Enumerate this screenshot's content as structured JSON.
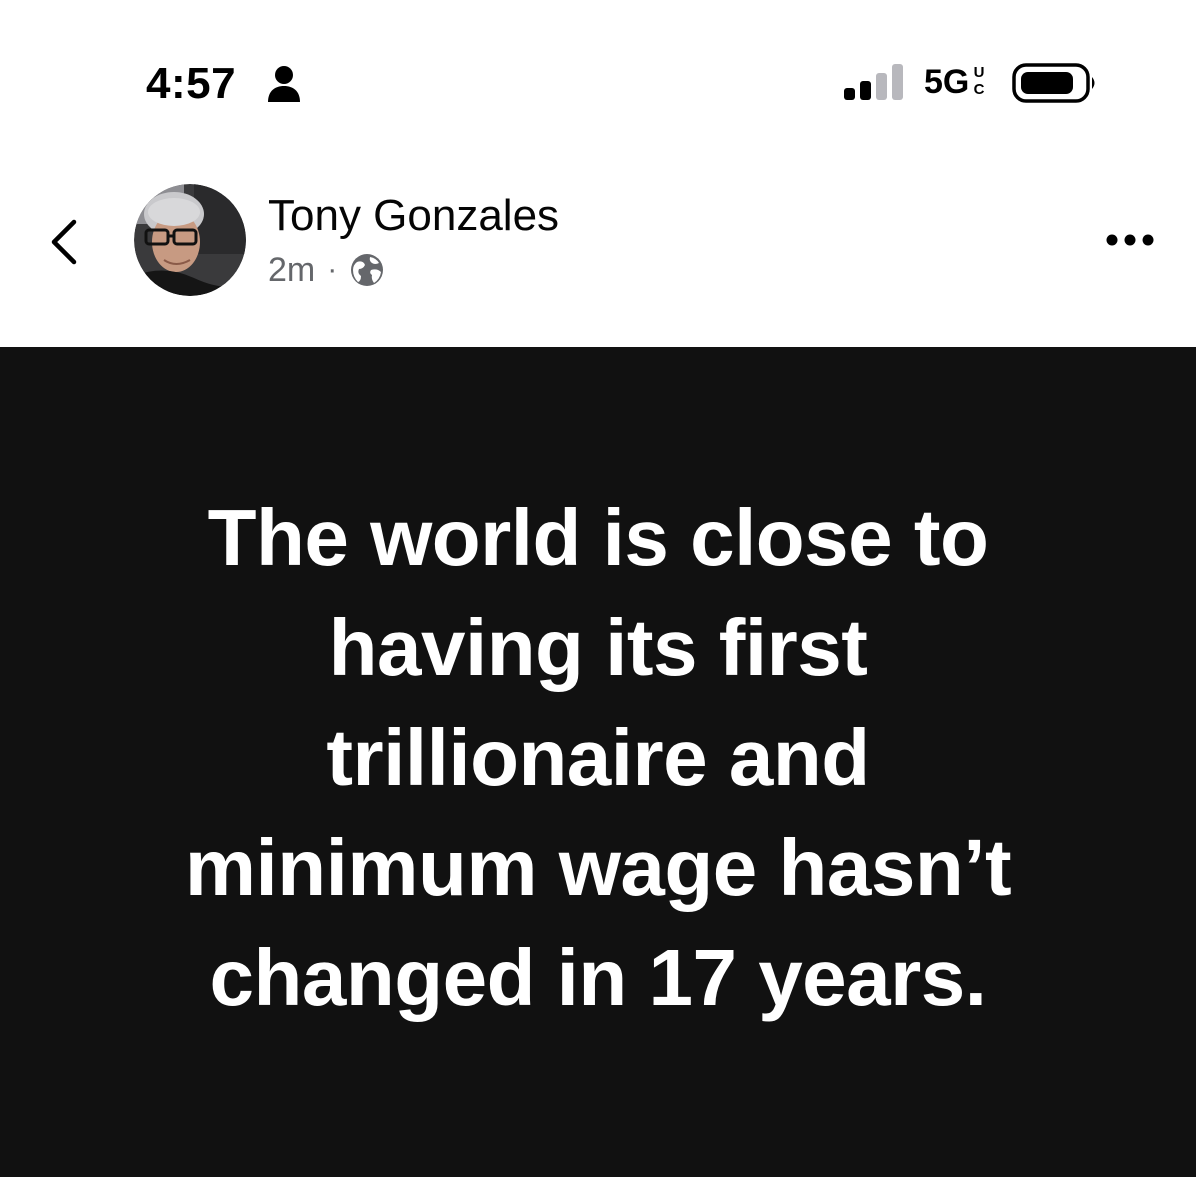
{
  "status_bar": {
    "time": "4:57",
    "person_icon": "person-icon",
    "signal_bars_active": 2,
    "signal_bars_total": 4,
    "network": "5G",
    "network_badge": [
      "U",
      "C"
    ],
    "battery_icon": "battery-icon"
  },
  "post": {
    "author": "Tony Gonzales",
    "time": "2m",
    "separator": "·",
    "audience_icon": "globe-icon",
    "back_icon": "chevron-left-icon",
    "more_icon": "more-horizontal-icon",
    "content_lines": [
      "The world is close to",
      "having its first",
      "trillionaire and",
      "minimum wage hasn’t",
      "changed in 17 years."
    ]
  },
  "colors": {
    "post_background": "#111111",
    "post_text": "#ffffff",
    "meta_text": "#65676b"
  }
}
